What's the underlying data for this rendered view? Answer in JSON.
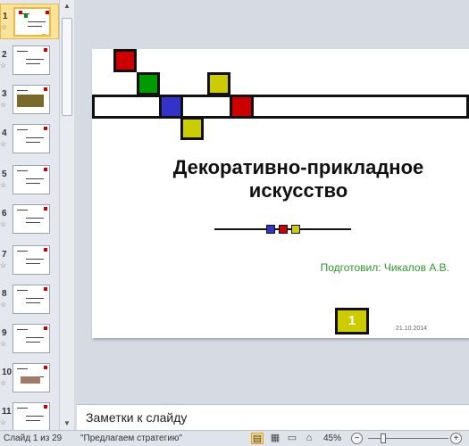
{
  "thumbnails": [
    {
      "num": "1",
      "star": "☆",
      "active": true
    },
    {
      "num": "2",
      "star": "☆",
      "active": false
    },
    {
      "num": "3",
      "star": "☆",
      "active": false
    },
    {
      "num": "4",
      "star": "☆",
      "active": false
    },
    {
      "num": "5",
      "star": "☆",
      "active": false
    },
    {
      "num": "6",
      "star": "☆",
      "active": false
    },
    {
      "num": "7",
      "star": "☆",
      "active": false
    },
    {
      "num": "8",
      "star": "☆",
      "active": false
    },
    {
      "num": "9",
      "star": "☆",
      "active": false
    },
    {
      "num": "10",
      "star": "☆",
      "active": false
    },
    {
      "num": "11",
      "star": "☆",
      "active": false
    }
  ],
  "slide": {
    "title": "Декоративно-прикладное искусство",
    "author": "Подготовил: Чикалов А.В.",
    "number": "1",
    "date": "21.10.2014",
    "colors": {
      "red": "#cc0000",
      "green": "#009900",
      "blue": "#3333cc",
      "yellow": "#cccc00"
    }
  },
  "notes": {
    "placeholder": "Заметки к слайду"
  },
  "status": {
    "slide_counter": "Слайд 1 из 29",
    "theme": "\"Предлагаем стратегию\"",
    "zoom": "45%",
    "zoom_minus": "−",
    "zoom_plus": "+",
    "zoom_level_percent": 45
  }
}
